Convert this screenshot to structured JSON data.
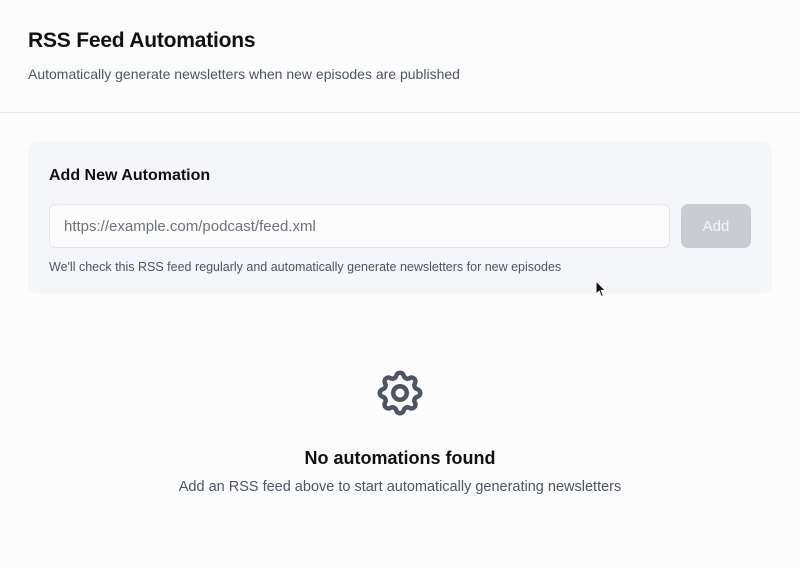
{
  "header": {
    "title": "RSS Feed Automations",
    "subtitle": "Automatically generate newsletters when new episodes are published"
  },
  "add_automation": {
    "title": "Add New Automation",
    "url_input": {
      "value": "",
      "placeholder": "https://example.com/podcast/feed.xml"
    },
    "add_button_label": "Add",
    "add_button_state": "disabled",
    "helper_text": "We'll check this RSS feed regularly and automatically generate newsletters for new episodes"
  },
  "empty_state": {
    "icon": "gear-icon",
    "title": "No automations found",
    "message": "Add an RSS feed above to start automatically generating newsletters"
  },
  "colors": {
    "background": "#fcfcfd",
    "card_background": "#f5f6f9",
    "button_disabled": "#c9ccd3",
    "icon": "#4b5563"
  }
}
